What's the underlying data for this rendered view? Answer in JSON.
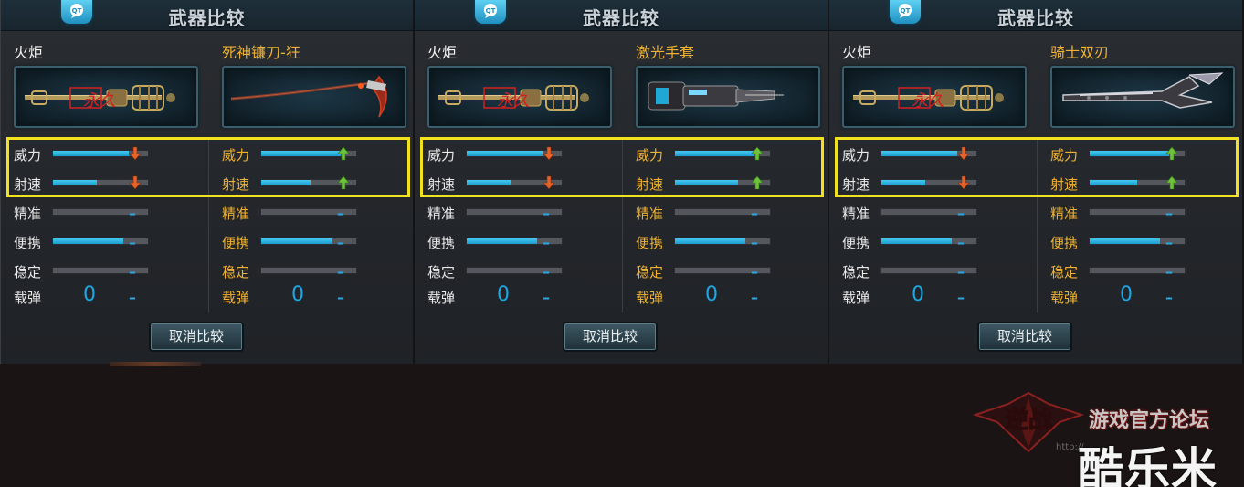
{
  "header": {
    "title": "武器比较"
  },
  "stat_labels": [
    "威力",
    "射速",
    "精准",
    "便携",
    "稳定",
    "载弹"
  ],
  "button": {
    "cancel_label": "取消比较"
  },
  "panels": [
    {
      "left": {
        "name": "火炬",
        "stats": [
          {
            "label": "威力",
            "fill": 0.8,
            "indicator": "down"
          },
          {
            "label": "射速",
            "fill": 0.46,
            "indicator": "down"
          },
          {
            "label": "精准",
            "fill": 0.0,
            "indicator": "–"
          },
          {
            "label": "便携",
            "fill": 0.74,
            "indicator": "–"
          },
          {
            "label": "稳定",
            "fill": 0.0,
            "indicator": "–"
          }
        ],
        "ammo": "0",
        "ammo_indicator": "–"
      },
      "right": {
        "name": "死神镰刀-狂",
        "stats": [
          {
            "label": "威力",
            "fill": 0.84,
            "indicator": "up"
          },
          {
            "label": "射速",
            "fill": 0.52,
            "indicator": "up"
          },
          {
            "label": "精准",
            "fill": 0.0,
            "indicator": "–"
          },
          {
            "label": "便携",
            "fill": 0.74,
            "indicator": "–"
          },
          {
            "label": "稳定",
            "fill": 0.0,
            "indicator": "–"
          }
        ],
        "ammo": "0",
        "ammo_indicator": "–"
      }
    },
    {
      "left": {
        "name": "火炬",
        "stats": [
          {
            "label": "威力",
            "fill": 0.8,
            "indicator": "down"
          },
          {
            "label": "射速",
            "fill": 0.46,
            "indicator": "down"
          },
          {
            "label": "精准",
            "fill": 0.0,
            "indicator": "–"
          },
          {
            "label": "便携",
            "fill": 0.74,
            "indicator": "–"
          },
          {
            "label": "稳定",
            "fill": 0.0,
            "indicator": "–"
          }
        ],
        "ammo": "0",
        "ammo_indicator": "–"
      },
      "right": {
        "name": "激光手套",
        "stats": [
          {
            "label": "威力",
            "fill": 0.84,
            "indicator": "up"
          },
          {
            "label": "射速",
            "fill": 0.66,
            "indicator": "up"
          },
          {
            "label": "精准",
            "fill": 0.0,
            "indicator": "–"
          },
          {
            "label": "便携",
            "fill": 0.74,
            "indicator": "–"
          },
          {
            "label": "稳定",
            "fill": 0.0,
            "indicator": "–"
          }
        ],
        "ammo": "0",
        "ammo_indicator": "–"
      }
    },
    {
      "left": {
        "name": "火炬",
        "stats": [
          {
            "label": "威力",
            "fill": 0.8,
            "indicator": "down"
          },
          {
            "label": "射速",
            "fill": 0.46,
            "indicator": "down"
          },
          {
            "label": "精准",
            "fill": 0.0,
            "indicator": "–"
          },
          {
            "label": "便携",
            "fill": 0.74,
            "indicator": "–"
          },
          {
            "label": "稳定",
            "fill": 0.0,
            "indicator": "–"
          }
        ],
        "ammo": "0",
        "ammo_indicator": "–"
      },
      "right": {
        "name": "骑士双刃",
        "stats": [
          {
            "label": "威力",
            "fill": 0.84,
            "indicator": "up"
          },
          {
            "label": "射速",
            "fill": 0.5,
            "indicator": "up"
          },
          {
            "label": "精准",
            "fill": 0.0,
            "indicator": "–"
          },
          {
            "label": "便携",
            "fill": 0.74,
            "indicator": "–"
          },
          {
            "label": "稳定",
            "fill": 0.0,
            "indicator": "–"
          }
        ],
        "ammo": "0",
        "ammo_indicator": "–"
      }
    }
  ],
  "watermark": {
    "game_logo_text": "逆战",
    "forum_text": "游戏官方论坛",
    "site_text": "酷乐米",
    "url_text": "http://"
  },
  "colors": {
    "bar_fill": "#2ab4e6",
    "arrow_up": "#6ec23a",
    "arrow_down": "#e8632a",
    "highlight": "#f1e11f",
    "right_label": "#f0b232"
  },
  "icons": {
    "header_logo": "chat-bubble-icon",
    "up": "arrow-up-icon",
    "down": "arrow-down-icon"
  }
}
